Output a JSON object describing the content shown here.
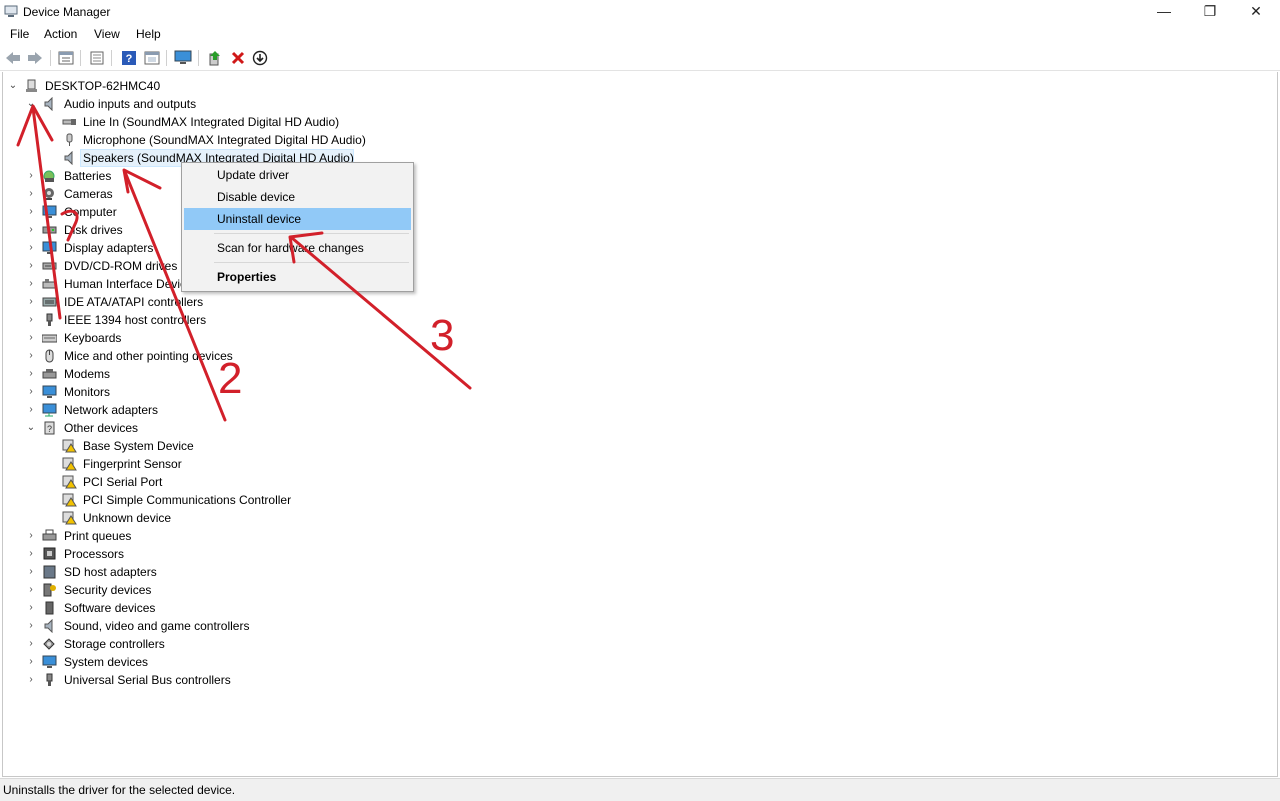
{
  "window": {
    "title": "Device Manager",
    "minimize": "—",
    "restore": "❐",
    "close": "✕"
  },
  "menu": [
    "File",
    "Action",
    "View",
    "Help"
  ],
  "toolbar": [
    "back-icon",
    "forward-icon",
    "properties-icon",
    "show-hidden-icon",
    "help-icon",
    "action-view-icon",
    "monitor-icon",
    "update-driver-icon",
    "uninstall-icon",
    "scan-changes-icon"
  ],
  "tree": {
    "root": "DESKTOP-62HMC40",
    "audio": {
      "label": "Audio inputs and outputs",
      "children": [
        "Line In (SoundMAX Integrated Digital HD Audio)",
        "Microphone (SoundMAX Integrated Digital HD Audio)",
        "Speakers (SoundMAX Integrated Digital HD Audio)"
      ]
    },
    "categories_a": [
      "Batteries",
      "Cameras",
      "Computer",
      "Disk drives",
      "Display adapters",
      "DVD/CD-ROM drives",
      "Human Interface Devices",
      "IDE ATA/ATAPI controllers",
      "IEEE 1394 host controllers",
      "Keyboards",
      "Mice and other pointing devices",
      "Modems",
      "Monitors",
      "Network adapters"
    ],
    "other": {
      "label": "Other devices",
      "children": [
        "Base System Device",
        "Fingerprint Sensor",
        "PCI Serial Port",
        "PCI Simple Communications Controller",
        "Unknown device"
      ]
    },
    "categories_b": [
      "Print queues",
      "Processors",
      "SD host adapters",
      "Security devices",
      "Software devices",
      "Sound, video and game controllers",
      "Storage controllers",
      "System devices",
      "Universal Serial Bus controllers"
    ]
  },
  "context_menu": {
    "update": "Update driver",
    "disable": "Disable device",
    "uninstall": "Uninstall device",
    "scan": "Scan for hardware changes",
    "properties": "Properties"
  },
  "status": "Uninstalls the driver for the selected device.",
  "annotations": {
    "one": "1",
    "two": "2",
    "three": "3",
    "color": "#d2202a"
  },
  "colors": {
    "highlight": "#91c9f7",
    "selection": "#e5f1fb"
  }
}
